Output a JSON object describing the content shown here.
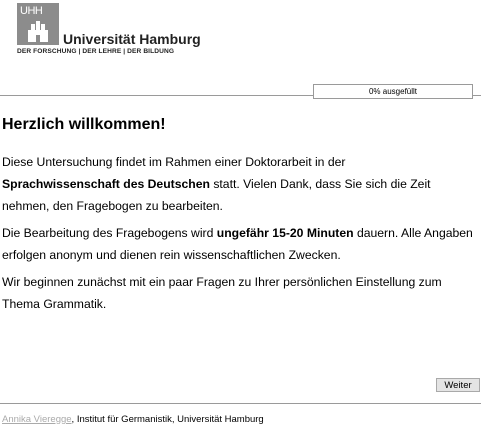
{
  "logo": {
    "mark": "UHH",
    "name": "Universität Hamburg",
    "tagline": "DER FORSCHUNG | DER LEHRE | DER BILDUNG"
  },
  "progress": {
    "label": "0% ausgefüllt",
    "percent": 0
  },
  "welcome": {
    "title": "Herzlich willkommen!",
    "p1_a": "Diese Untersuchung findet im Rahmen einer Doktorarbeit in der",
    "p1_b": "Sprachwissenschaft des Deutschen",
    "p1_c": " statt. Vielen Dank, dass Sie sich die Zeit nehmen, den Fragebogen zu bearbeiten.",
    "p2_a": "Die Bearbeitung des Fragebogens wird ",
    "p2_b": "ungefähr 15-20 Minuten",
    "p2_c": " dauern. Alle Angaben erfolgen anonym und dienen rein wissenschaftlichen Zwecken.",
    "p3": "Wir beginnen zunächst mit ein paar Fragen zu Ihrer persönlichen Einstellung zum Thema Grammatik."
  },
  "buttons": {
    "next": "Weiter"
  },
  "footer": {
    "author_link": "Annika Vieregge",
    "rest": ", Institut für Germanistik, Universität Hamburg"
  }
}
